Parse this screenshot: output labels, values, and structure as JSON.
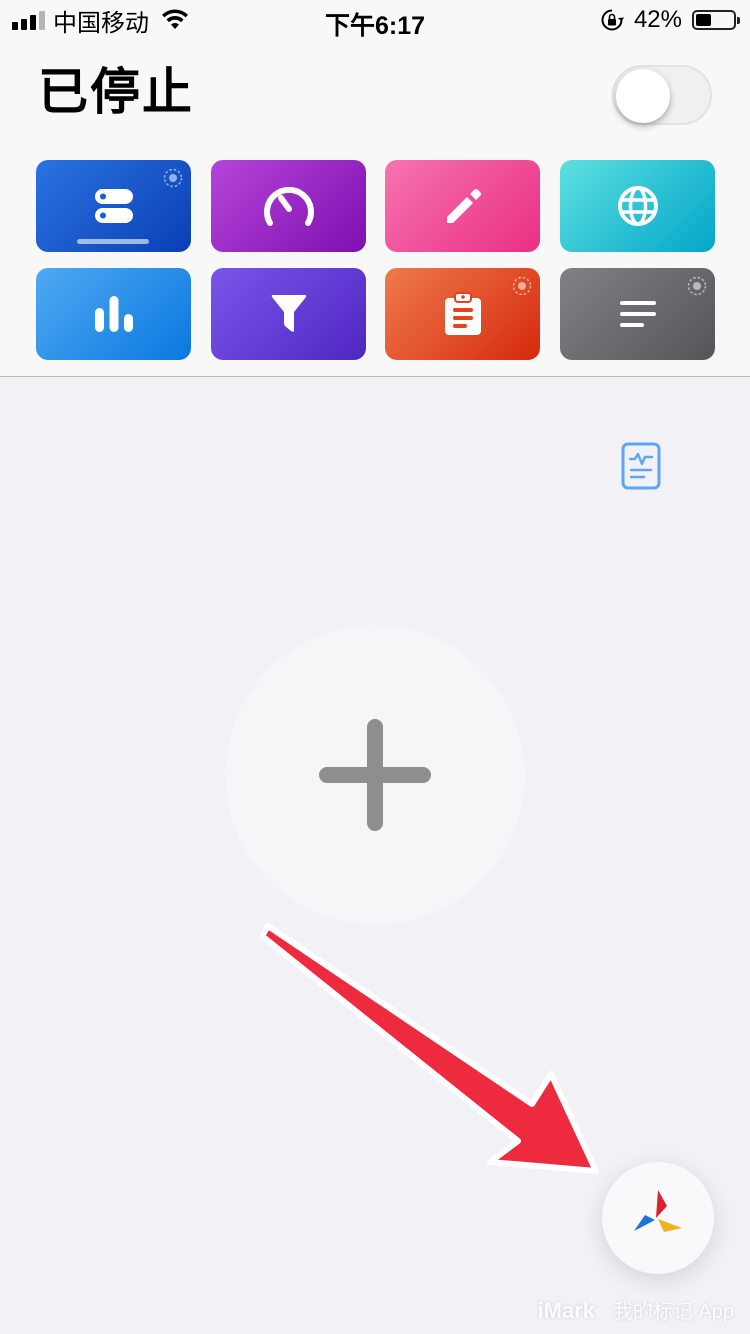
{
  "status_bar": {
    "carrier": "中国移动",
    "time": "下午6:17",
    "battery_text": "42%",
    "battery_level": 0.42
  },
  "header": {
    "title": "已停止",
    "toggle_on": false
  },
  "tiles": [
    {
      "icon": "server-icon",
      "color_start": "#2a73e3",
      "color_end": "#0a3fb5",
      "selected": true,
      "badge": true
    },
    {
      "icon": "speedometer-icon",
      "color_start": "#b445d9",
      "color_end": "#7f0fb0",
      "selected": false,
      "badge": false
    },
    {
      "icon": "pencil-icon",
      "color_start": "#f673b0",
      "color_end": "#ea2f83",
      "selected": false,
      "badge": false
    },
    {
      "icon": "globe-icon",
      "color_start": "#5ce0e0",
      "color_end": "#03a6c9",
      "selected": false,
      "badge": false
    },
    {
      "icon": "bar-chart-icon",
      "color_start": "#4fa9f2",
      "color_end": "#0a78e0",
      "selected": false,
      "badge": false
    },
    {
      "icon": "filter-icon",
      "color_start": "#7b55ea",
      "color_end": "#4d27c0",
      "selected": false,
      "badge": false
    },
    {
      "icon": "clipboard-icon",
      "color_start": "#ef7a4c",
      "color_end": "#d62a0d",
      "selected": false,
      "badge": true
    },
    {
      "icon": "text-lines-icon",
      "color_start": "#808086",
      "color_end": "#555559",
      "selected": false,
      "badge": true
    }
  ],
  "main": {
    "log_icon": "activity-document-icon",
    "add_icon": "plus-icon"
  },
  "annotation": {
    "arrow_color": "#ee2a3f"
  },
  "fab": {
    "icon": "pinwheel-logo-icon"
  },
  "watermark": {
    "brand": "iMark",
    "separator": "·",
    "text": "我的标记 App"
  }
}
